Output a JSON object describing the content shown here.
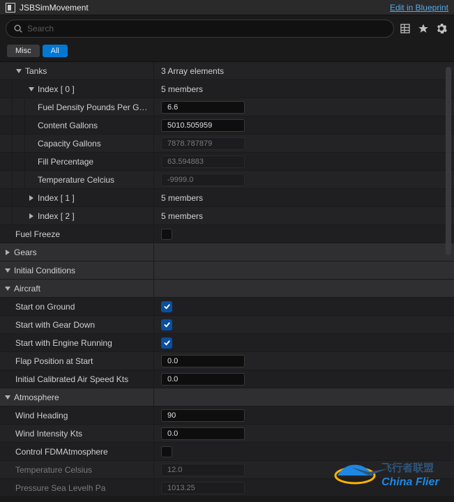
{
  "header": {
    "title": "JSBSimMovement",
    "blueprint_link": "Edit in Blueprint"
  },
  "search": {
    "placeholder": "Search"
  },
  "filters": {
    "misc": "Misc",
    "all": "All"
  },
  "tanks": {
    "label": "Tanks",
    "summary": "3 Array elements",
    "idx0": {
      "label": "Index [ 0 ]",
      "summary": "5 members",
      "fuel_density_label": "Fuel Density Pounds Per Gall…",
      "fuel_density_value": "6.6",
      "content_label": "Content Gallons",
      "content_value": "5010.505959",
      "capacity_label": "Capacity Gallons",
      "capacity_value": "7878.787879",
      "fill_label": "Fill Percentage",
      "fill_value": "63.594883",
      "temp_label": "Temperature Celcius",
      "temp_value": "-9999.0"
    },
    "idx1": {
      "label": "Index [ 1 ]",
      "summary": "5 members"
    },
    "idx2": {
      "label": "Index [ 2 ]",
      "summary": "5 members"
    },
    "fuel_freeze_label": "Fuel Freeze"
  },
  "gears": {
    "label": "Gears"
  },
  "init": {
    "label": "Initial Conditions"
  },
  "aircraft": {
    "label": "Aircraft",
    "start_ground": "Start on Ground",
    "start_gear": "Start with Gear Down",
    "start_engine": "Start with Engine Running",
    "flap_label": "Flap Position at Start",
    "flap_value": "0.0",
    "ias_label": "Initial Calibrated Air Speed Kts",
    "ias_value": "0.0"
  },
  "atmos": {
    "label": "Atmosphere",
    "wind_heading_label": "Wind Heading",
    "wind_heading_value": "90",
    "wind_intensity_label": "Wind Intensity Kts",
    "wind_intensity_value": "0.0",
    "control_label": "Control FDMAtmosphere",
    "temp_label": "Temperature Celsius",
    "temp_value": "12.0",
    "pressure_label": "Pressure Sea Levelh Pa",
    "pressure_value": "1013.25"
  },
  "watermark": {
    "line1": "飞行者联盟",
    "line2": "China Flier"
  }
}
